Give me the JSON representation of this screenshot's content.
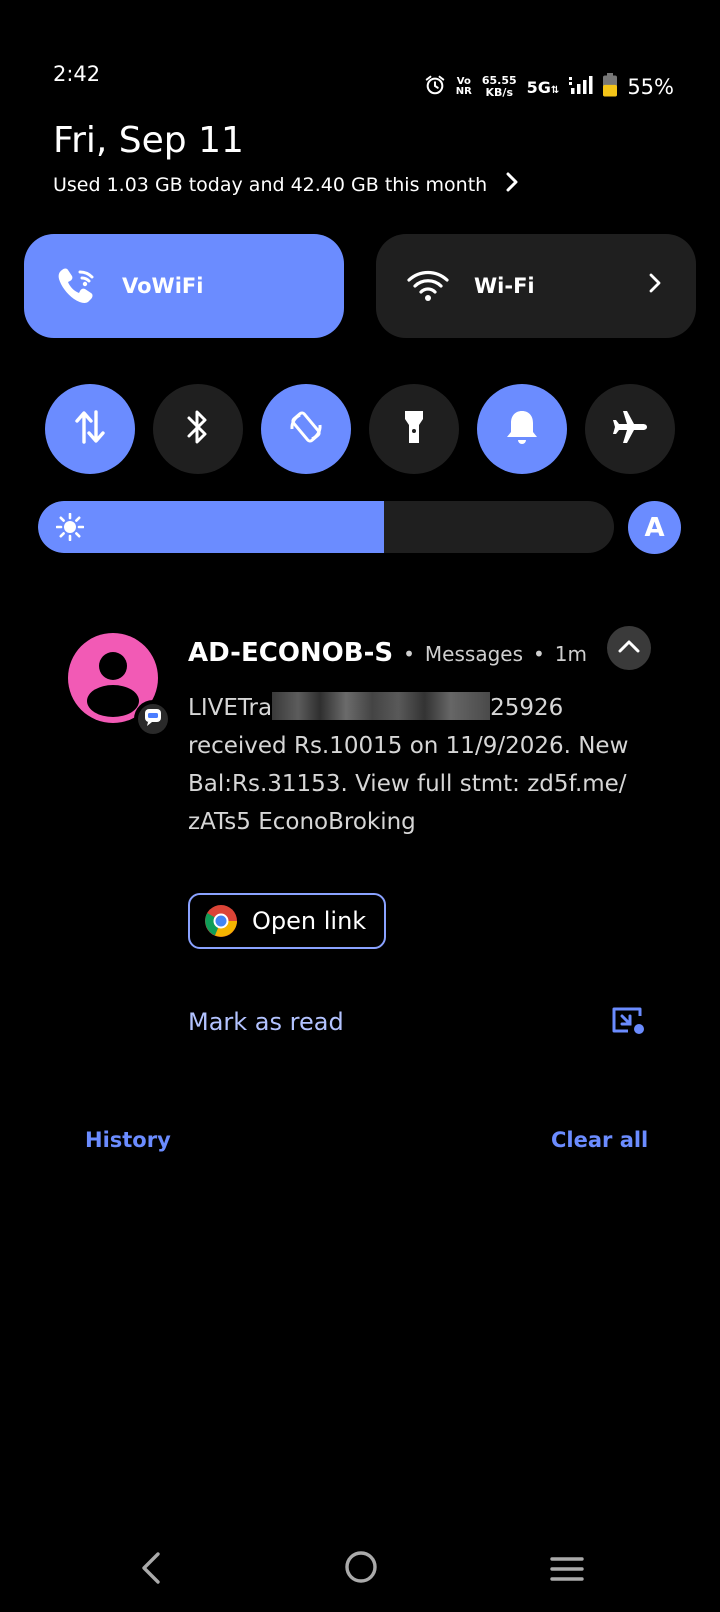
{
  "status_bar": {
    "time": "2:42",
    "vonr_top": "Vo",
    "vonr_bottom": "NR",
    "speed_value": "65.55",
    "speed_unit": "KB/s",
    "network": "5G",
    "battery_percent": "55%",
    "battery_level": 0.55,
    "icons": [
      "alarm-icon",
      "signal-icon",
      "battery-icon"
    ]
  },
  "header": {
    "date": "Fri, Sep 11",
    "data_usage": "Used 1.03 GB today and 42.40 GB this month"
  },
  "tiles": [
    {
      "label": "VoWiFi",
      "icon": "wifi-calling-icon",
      "active": true
    },
    {
      "label": "Wi-Fi",
      "icon": "wifi-icon",
      "active": false
    }
  ],
  "toggles": [
    {
      "name": "mobile-data",
      "icon": "data-arrows-icon",
      "active": true
    },
    {
      "name": "bluetooth",
      "icon": "bluetooth-icon",
      "active": false
    },
    {
      "name": "auto-rotate",
      "icon": "rotate-icon",
      "active": true
    },
    {
      "name": "flashlight",
      "icon": "flashlight-icon",
      "active": false
    },
    {
      "name": "sound",
      "icon": "bell-icon",
      "active": true
    },
    {
      "name": "airplane-mode",
      "icon": "airplane-icon",
      "active": false
    }
  ],
  "brightness": {
    "level": 0.6,
    "auto_label": "A"
  },
  "notification": {
    "sender": "AD-ECONOB-S",
    "app": "Messages",
    "age": "1m",
    "body_prefix": "LIVETra",
    "body_suffix": "25926",
    "body_rest": "received Rs.10015 on 11/9/2026. New Bal:Rs.31153. View full stmt: zd5f.me/ zATs5 EconoBroking",
    "open_link_label": "Open link",
    "mark_read_label": "Mark as read"
  },
  "footer": {
    "history_label": "History",
    "clear_all_label": "Clear all"
  },
  "colors": {
    "accent": "#6b8cff",
    "tile_off": "#1f1f1f",
    "avatar": "#f25ab5",
    "battery": "#f5c518"
  }
}
